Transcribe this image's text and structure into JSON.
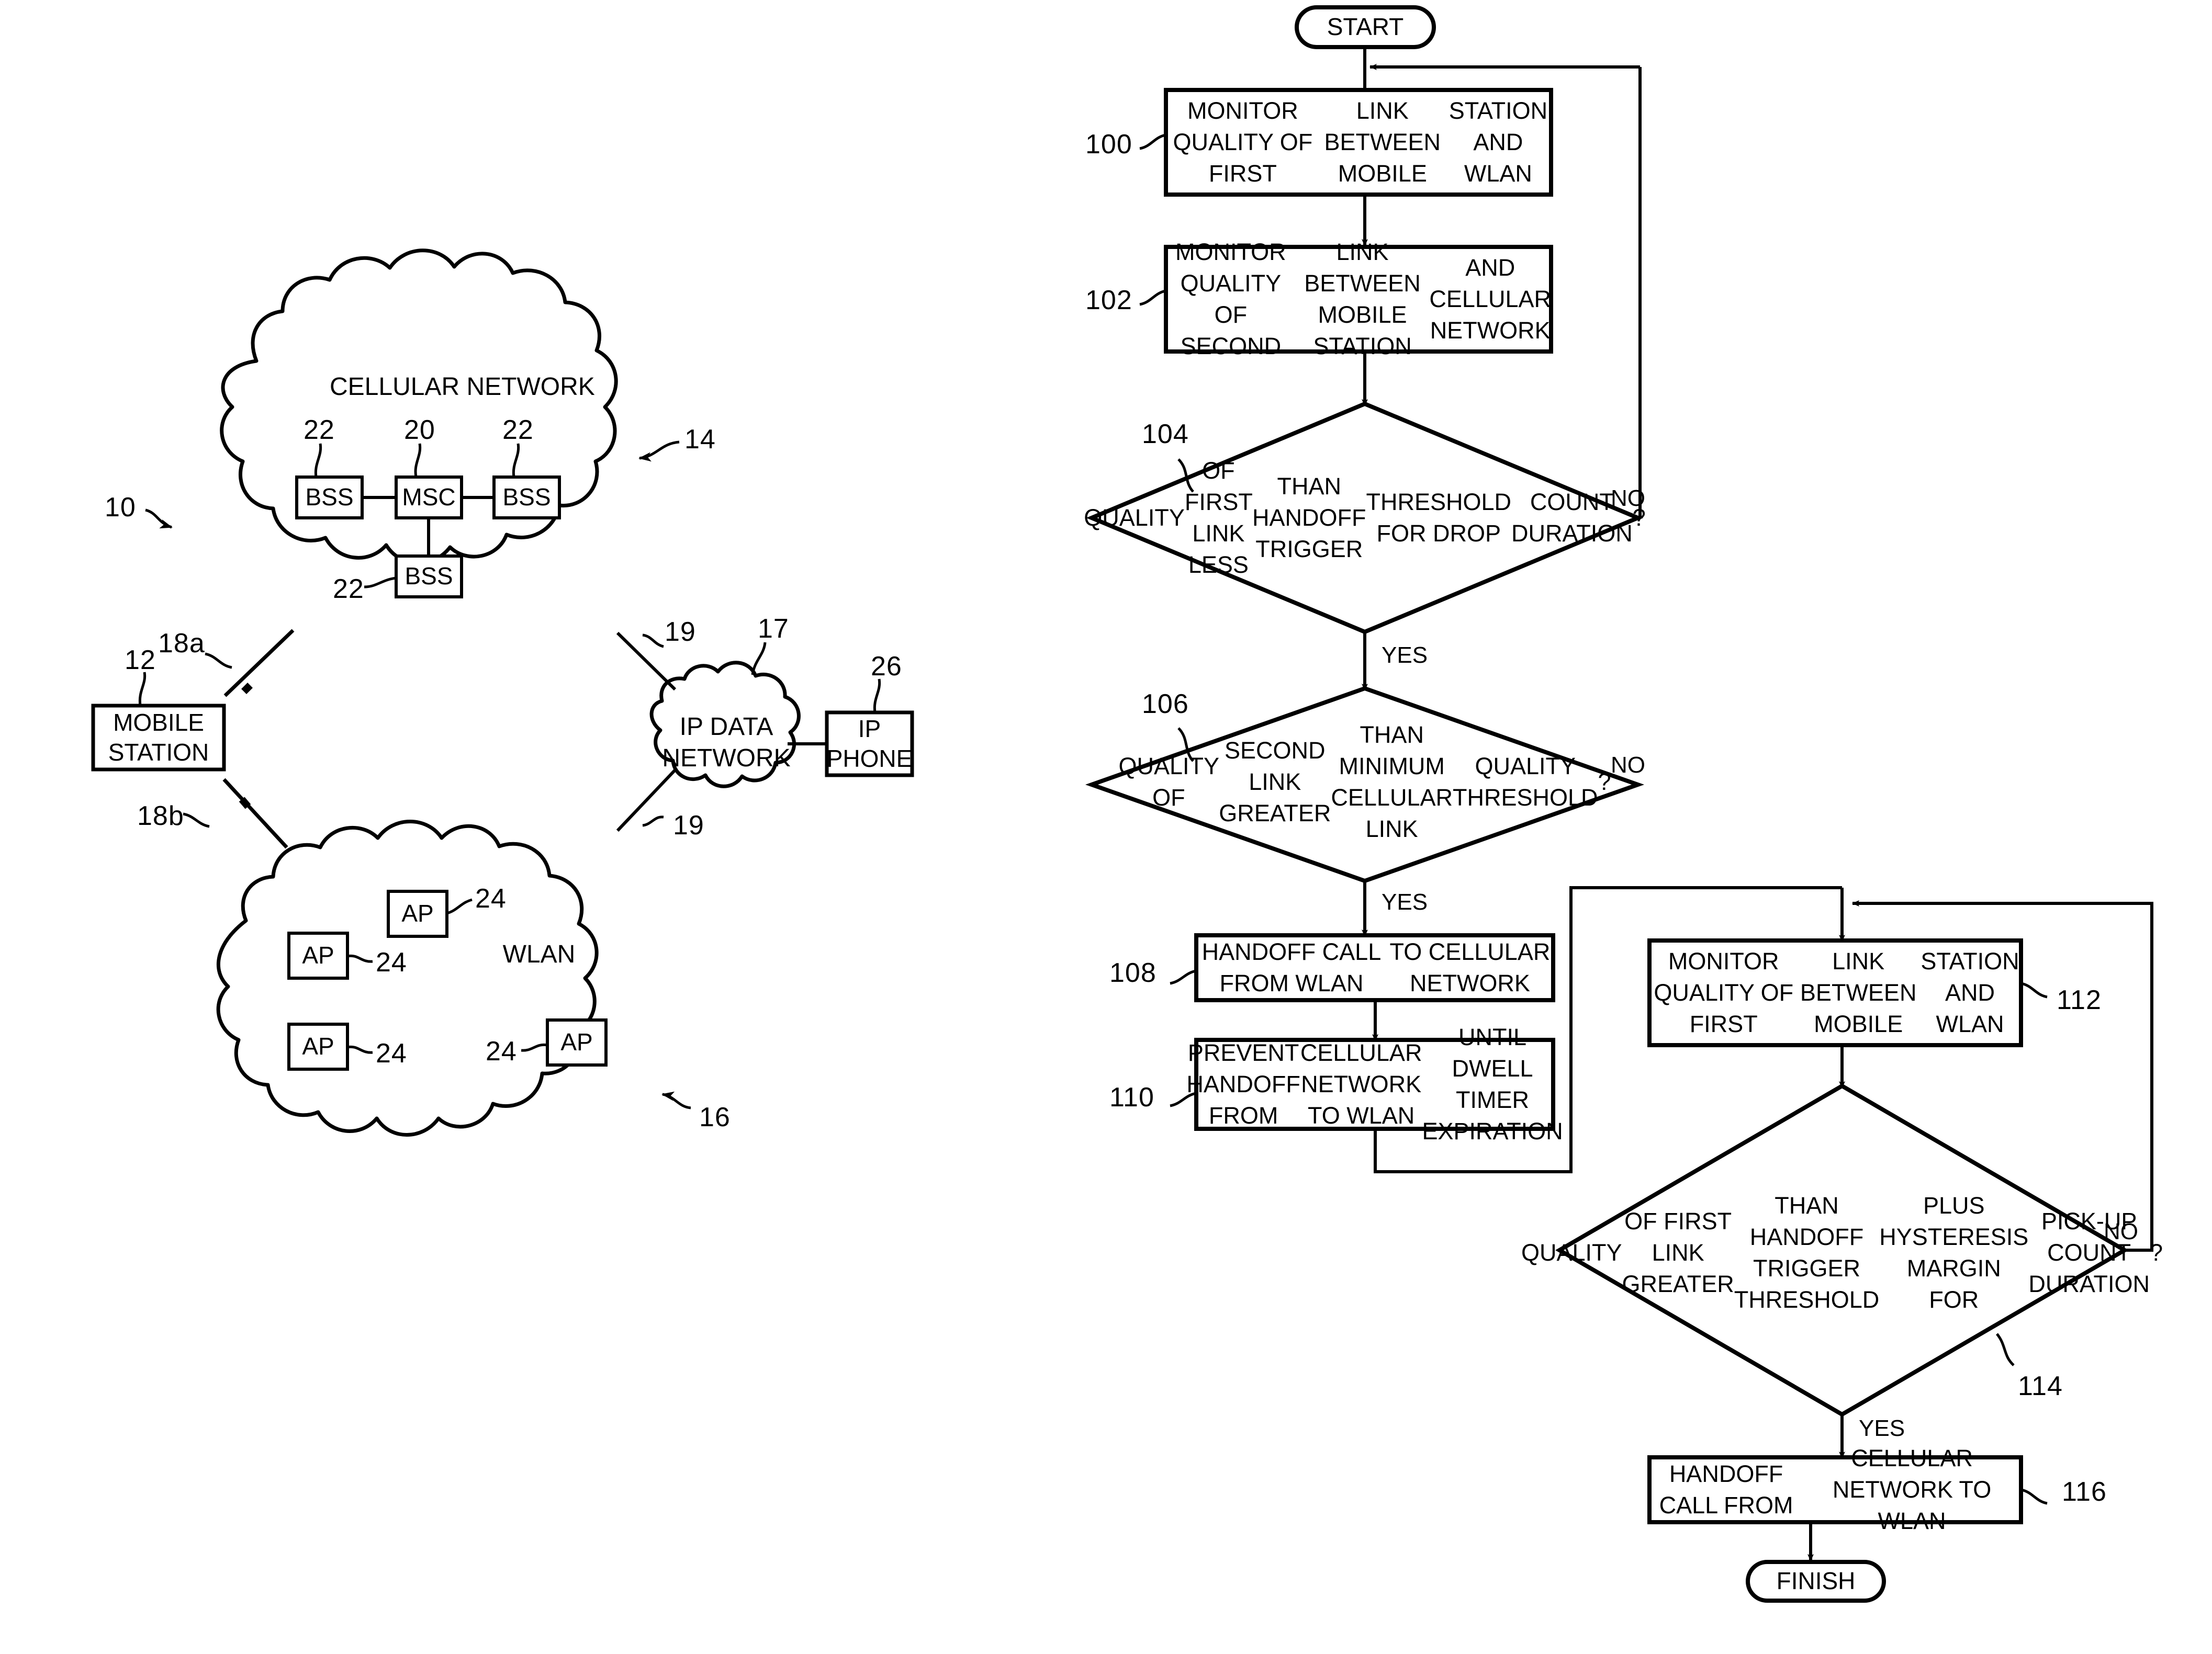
{
  "figure": {
    "left_diagram": {
      "system_ref": "10",
      "cellular_cloud": {
        "label": "CELLULAR NETWORK",
        "ref": "14",
        "nodes": [
          {
            "label": "BSS",
            "ref": "22"
          },
          {
            "label": "MSC",
            "ref": "20"
          },
          {
            "label": "BSS",
            "ref": "22"
          },
          {
            "label": "BSS",
            "ref": "22"
          }
        ]
      },
      "mobile_station": {
        "label_line1": "MOBILE",
        "label_line2": "STATION",
        "ref": "12"
      },
      "links": [
        {
          "label": "18a"
        },
        {
          "label": "18b"
        }
      ],
      "ip_data_network": {
        "label_line1": "IP DATA",
        "label_line2": "NETWORK",
        "ref": "17"
      },
      "ip_phone": {
        "label_line1": "IP",
        "label_line2": "PHONE",
        "ref": "26"
      },
      "ip_links": [
        {
          "label": "19"
        },
        {
          "label": "19"
        }
      ],
      "wlan_cloud": {
        "label": "WLAN",
        "ref": "16",
        "access_points": [
          {
            "label": "AP",
            "ref": "24"
          },
          {
            "label": "AP",
            "ref": "24"
          },
          {
            "label": "AP",
            "ref": "24"
          },
          {
            "label": "AP",
            "ref": "24"
          }
        ]
      }
    },
    "flowchart": {
      "start": {
        "label": "START"
      },
      "finish": {
        "label": "FINISH"
      },
      "steps": [
        {
          "ref": "100",
          "type": "process",
          "text": "MONITOR QUALITY OF FIRST\nLINK BETWEEN MOBILE\nSTATION AND WLAN"
        },
        {
          "ref": "102",
          "type": "process",
          "text": "MONITOR QUALITY OF SECOND\nLINK BETWEEN MOBILE STATION\nAND CELLULAR NETWORK"
        },
        {
          "ref": "104",
          "type": "decision",
          "text": "QUALITY\nOF FIRST LINK LESS\nTHAN HANDOFF TRIGGER\nTHRESHOLD FOR DROP\nCOUNT DURATION\n?"
        },
        {
          "ref": "106",
          "type": "decision",
          "text": "QUALITY OF\nSECOND LINK GREATER\nTHAN MINIMUM CELLULAR LINK\nQUALITY THRESHOLD\n?"
        },
        {
          "ref": "108",
          "type": "process",
          "text": "HANDOFF CALL FROM WLAN\nTO CELLULAR NETWORK"
        },
        {
          "ref": "110",
          "type": "process",
          "text": "PREVENT HANDOFF FROM\nCELLULAR NETWORK TO WLAN\nUNTIL DWELL TIMER EXPIRATION"
        },
        {
          "ref": "112",
          "type": "process",
          "text": "MONITOR QUALITY OF FIRST\nLINK BETWEEN MOBILE\nSTATION AND WLAN"
        },
        {
          "ref": "114",
          "type": "decision",
          "text": "QUALITY\nOF FIRST LINK GREATER\nTHAN HANDOFF TRIGGER THRESHOLD\nPLUS HYSTERESIS MARGIN FOR\nPICK-UP COUNT DURATION\n?"
        },
        {
          "ref": "116",
          "type": "process",
          "text": "HANDOFF CALL FROM\nCELLULAR NETWORK TO WLAN"
        }
      ],
      "branch_labels": {
        "no": "NO",
        "yes": "YES"
      },
      "edges": [
        {
          "from": "104",
          "label": "NO"
        },
        {
          "from": "104",
          "label": "YES"
        },
        {
          "from": "106",
          "label": "NO"
        },
        {
          "from": "106",
          "label": "YES"
        },
        {
          "from": "114",
          "label": "NO"
        },
        {
          "from": "114",
          "label": "YES"
        }
      ]
    }
  },
  "colors": {
    "ink": "#000000",
    "paper": "#ffffff"
  }
}
